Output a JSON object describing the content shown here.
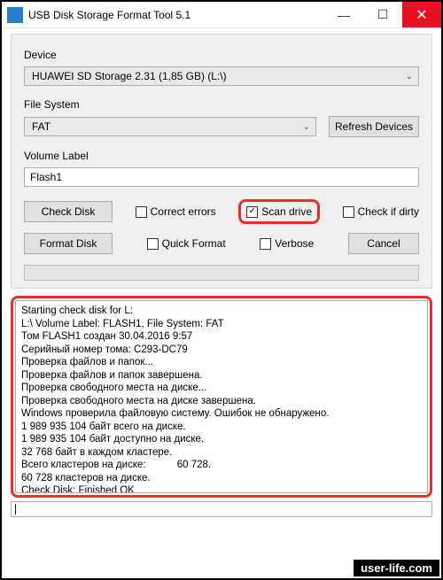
{
  "window": {
    "title": "USB Disk Storage Format Tool 5.1"
  },
  "labels": {
    "device": "Device",
    "filesystem": "File System",
    "volume": "Volume Label"
  },
  "device": {
    "value": "HUAWEI  SD Storage  2.31 (1,85 GB) (L:\\)"
  },
  "filesystem": {
    "value": "FAT"
  },
  "volume": {
    "value": "Flash1"
  },
  "buttons": {
    "refresh": "Refresh Devices",
    "checkdisk": "Check Disk",
    "formatdisk": "Format Disk",
    "cancel": "Cancel"
  },
  "checks": {
    "correct": {
      "label": "Correct errors",
      "checked": false
    },
    "scan": {
      "label": "Scan drive",
      "checked": true
    },
    "dirty": {
      "label": "Check if dirty",
      "checked": false
    },
    "quick": {
      "label": "Quick Format",
      "checked": false
    },
    "verbose": {
      "label": "Verbose",
      "checked": false
    }
  },
  "log": "Starting check disk for L:\nL:\\ Volume Label: FLASH1, File System: FAT\nТом FLASH1 создан 30.04.2016 9:57\nСерийный номер тома: C293-DC79\nПроверка файлов и папок...\nПроверка файлов и папок завершена.\nПроверка свободного места на диске...\nПроверка свободного места на диске завершена.\nWindows проверила файловую систему. Ошибок не обнаружено.\n1 989 935 104 байт всего на диске.\n1 989 935 104 байт доступно на диске.\n32 768 байт в каждом кластере.\nВсего кластеров на диске:           60 728.\n60 728 кластеров на диске.\nCheck Disk: Finished OK",
  "watermark": "user-life.com",
  "icons": {
    "check": "✓",
    "chevron": "⌄",
    "close": "✕"
  }
}
